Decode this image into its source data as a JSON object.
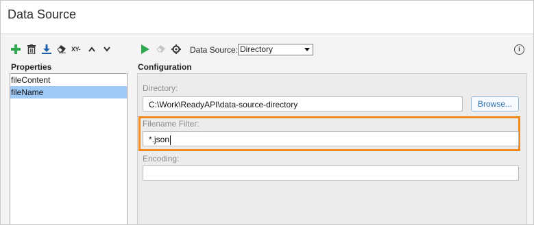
{
  "window": {
    "title": "Data Source"
  },
  "toolbar_left": {
    "icons": [
      "add-icon",
      "delete-icon",
      "download-icon",
      "eraser-icon",
      "xy-icon",
      "chevron-up-icon",
      "chevron-down-icon"
    ],
    "xy_text": "XY-"
  },
  "toolbar_right": {
    "icons": [
      "run-icon",
      "eraser-icon",
      "gear-icon"
    ],
    "data_source_label": "Data Source:",
    "data_source_value": "Directory",
    "info_text": "i"
  },
  "properties": {
    "heading": "Properties",
    "items": [
      {
        "label": "fileContent",
        "selected": false
      },
      {
        "label": "fileName",
        "selected": true
      }
    ]
  },
  "configuration": {
    "heading": "Configuration",
    "directory_label": "Directory:",
    "directory_value": "C:\\Work\\ReadyAPI\\data-source-directory",
    "browse_label": "Browse...",
    "filename_filter_label": "Filename Filter:",
    "filename_filter_value": "*.json",
    "encoding_label": "Encoding:",
    "encoding_value": ""
  },
  "colors": {
    "highlight": "#f08a1f",
    "selection": "#9ec8f5",
    "add_green": "#2fa84f",
    "run_green": "#2fa84f"
  }
}
